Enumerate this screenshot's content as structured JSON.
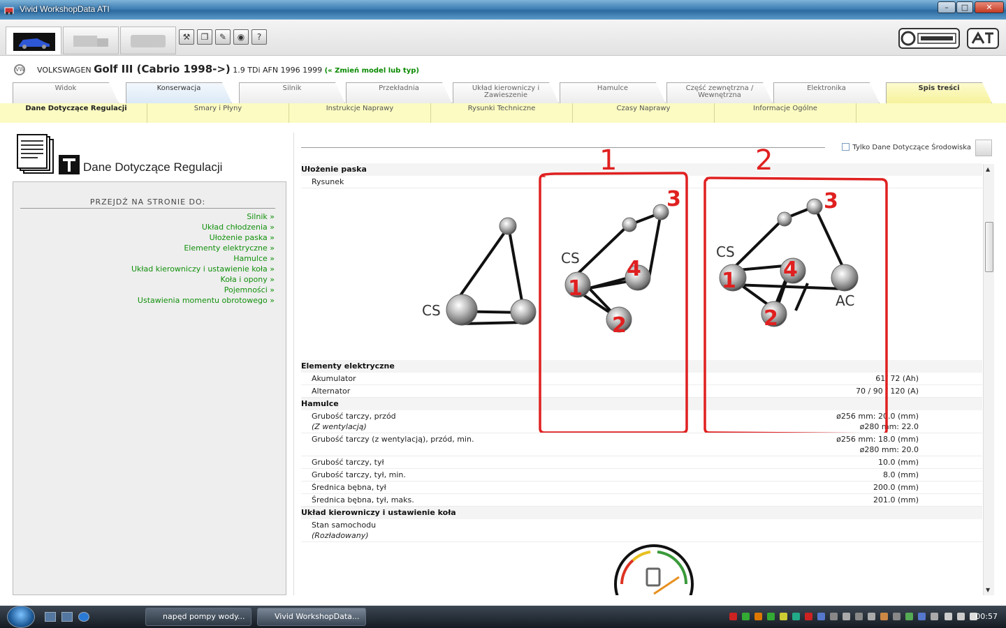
{
  "window": {
    "title": "Vivid WorkshopData ATI"
  },
  "vehicle": {
    "make": "VOLKSWAGEN",
    "model": "Golf III (Cabrio 1998->)",
    "engine": "1.9 TDi AFN 1996 1999",
    "change_link": "(« Zmień model lub typ)"
  },
  "main_tabs": [
    {
      "label": "Widok"
    },
    {
      "label": "Konserwacja"
    },
    {
      "label": "Silnik"
    },
    {
      "label": "Przekładnia"
    },
    {
      "label": "Układ kierowniczy i Zawieszenie"
    },
    {
      "label": "Hamulce"
    },
    {
      "label": "Część zewnętrzna / Wewnętrzna"
    },
    {
      "label": "Elektronika"
    },
    {
      "label": "Spis treści"
    }
  ],
  "sub_tabs": [
    {
      "label": "Dane Dotyczące Regulacji"
    },
    {
      "label": "Smary i Płyny"
    },
    {
      "label": "Instrukcje Naprawy"
    },
    {
      "label": "Rysunki Techniczne"
    },
    {
      "label": "Czasy Naprawy"
    },
    {
      "label": "Informacje Ogólne"
    }
  ],
  "left": {
    "page_title": "Dane Dotyczące Regulacji",
    "nav_title": "PRZEJDŹ NA STRONIE DO:",
    "nav_links": [
      "Silnik »",
      "Układ chłodzenia »",
      "Ułożenie paska »",
      "Elementy elektryczne »",
      "Hamulce »",
      "Układ kierowniczy i ustawienie koła »",
      "Koła i opony »",
      "Pojemności »",
      "Ustawienia momentu obrotowego »"
    ]
  },
  "content": {
    "env_checkbox_label": "Tylko Dane Dotyczące Środowiska",
    "belt_section": "Ułożenie paska",
    "belt_row": "Rysunek",
    "diagram": {
      "left_label": "CS",
      "mid_label": "CS",
      "right_label_cs": "CS",
      "right_label_ac": "AC"
    },
    "annotations": {
      "box1_num": "1",
      "box2_num": "2",
      "n1": "1",
      "n2": "2",
      "n3": "3",
      "n4": "4"
    },
    "elec_section": "Elementy elektryczne",
    "elec_rows": [
      {
        "label": "Akumulator",
        "value": "61/ 72 (Ah)"
      },
      {
        "label": "Alternator",
        "value": "70 / 90 / 120 (A)"
      }
    ],
    "brake_section": "Hamulce",
    "brake_rows": [
      {
        "label": "Grubość tarczy, przód",
        "sub": "(Z wentylacją)",
        "value": "ø256 mm: 20.0 (mm)",
        "value2": "ø280 mm: 22.0"
      },
      {
        "label": "Grubość tarczy (z wentylacją), przód, min.",
        "sub": "",
        "value": "ø256 mm: 18.0 (mm)",
        "value2": "ø280 mm: 20.0"
      },
      {
        "label": "Grubość tarczy, tył",
        "value": "10.0 (mm)"
      },
      {
        "label": "Grubość tarczy, tył, min.",
        "value": "8.0 (mm)"
      },
      {
        "label": "Średnica bębna, tył",
        "value": "200.0 (mm)"
      },
      {
        "label": "Średnica bębna, tył, maks.",
        "value": "201.0 (mm)"
      }
    ],
    "steer_section": "Układ kierowniczy i ustawienie koła",
    "steer_row": {
      "label": "Stan samochodu",
      "sub": "(Rozładowany)"
    }
  },
  "taskbar": {
    "tasks": [
      "napęd pompy wody...",
      "Vivid WorkshopData..."
    ],
    "clock": "00:57"
  },
  "colors": {
    "link_green": "#12900c",
    "annotation_red": "#e02020",
    "subtab_yellow": "#fbfbc2"
  }
}
